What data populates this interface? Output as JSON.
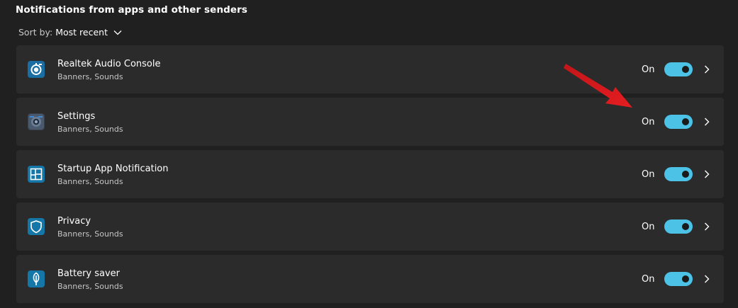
{
  "section": {
    "title": "Notifications from apps and other senders"
  },
  "sort": {
    "label": "Sort by:",
    "value": "Most recent",
    "icon": "chevron-down-icon"
  },
  "apps": [
    {
      "name": "Realtek Audio Console",
      "subtitle": "Banners, Sounds",
      "state": "On",
      "enabled": true,
      "icon": "realtek-audio-icon",
      "icon_bg": "#1b6ea3"
    },
    {
      "name": "Settings",
      "subtitle": "Banners, Sounds",
      "state": "On",
      "enabled": true,
      "icon": "settings-gear-icon",
      "icon_bg": "#3a3f4a"
    },
    {
      "name": "Startup App Notification",
      "subtitle": "Banners, Sounds",
      "state": "On",
      "enabled": true,
      "icon": "startup-app-icon",
      "icon_bg": "#1576a8"
    },
    {
      "name": "Privacy",
      "subtitle": "Banners, Sounds",
      "state": "On",
      "enabled": true,
      "icon": "shield-icon",
      "icon_bg": "#1576a8"
    },
    {
      "name": "Battery saver",
      "subtitle": "Banners, Sounds",
      "state": "On",
      "enabled": true,
      "icon": "leaf-icon",
      "icon_bg": "#1576a8"
    }
  ],
  "colors": {
    "background": "#202020",
    "card": "#2b2b2b",
    "toggle_on": "#4cc2e6",
    "annotation_arrow": "#e0191c"
  }
}
